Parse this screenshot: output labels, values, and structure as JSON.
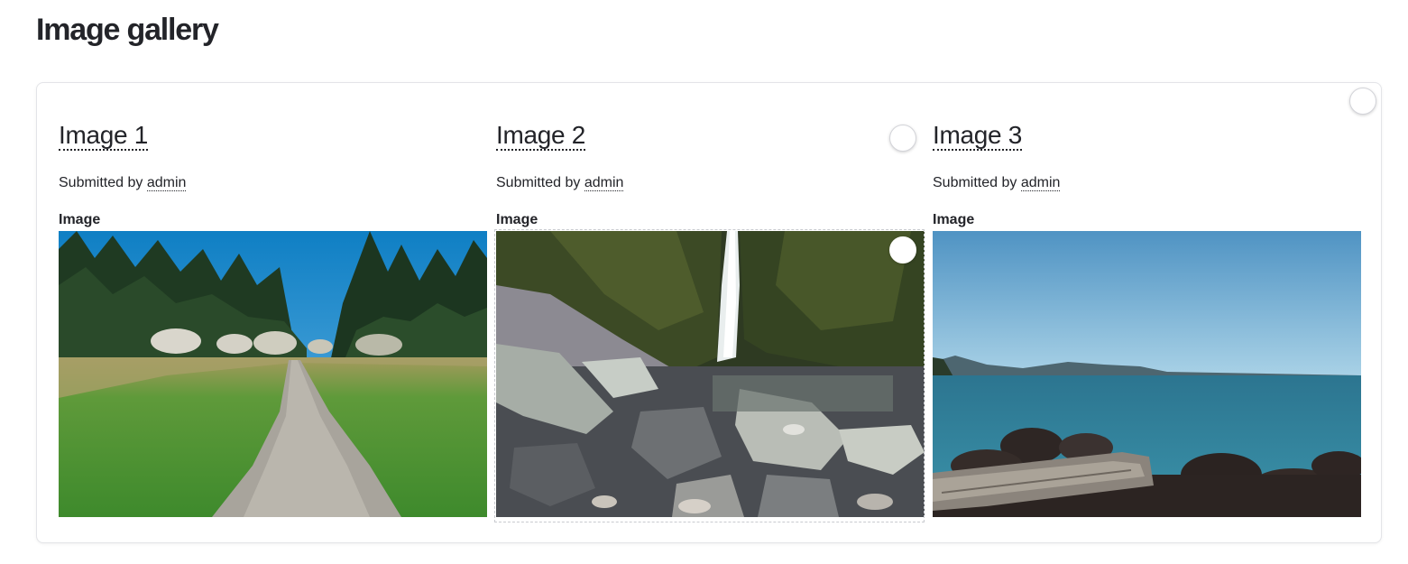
{
  "page": {
    "title": "Image gallery"
  },
  "gallery": {
    "items": [
      {
        "title": "Image 1",
        "submitted_prefix": "Submitted by",
        "author": "admin",
        "field_label": "Image",
        "image_subject": "meadow-path-forest"
      },
      {
        "title": "Image 2",
        "submitted_prefix": "Submitted by",
        "author": "admin",
        "field_label": "Image",
        "image_subject": "waterfall-rocky-gorge"
      },
      {
        "title": "Image 3",
        "submitted_prefix": "Submitted by",
        "author": "admin",
        "field_label": "Image",
        "image_subject": "sea-coast-driftwood"
      }
    ]
  },
  "colors": {
    "text": "#232429",
    "card_border": "#e3e4e8",
    "sky_blue": "#1e8fd0",
    "grass_green": "#3f8a2d",
    "sea_teal": "#2f7f95"
  }
}
